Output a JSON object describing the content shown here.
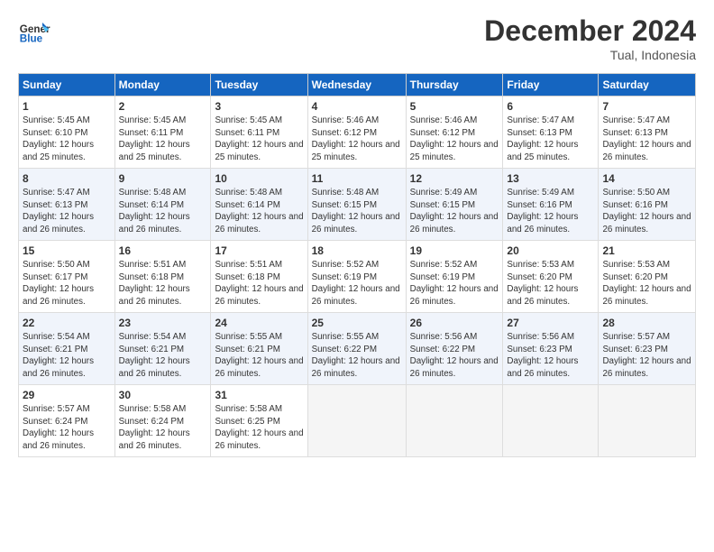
{
  "header": {
    "logo_general": "General",
    "logo_blue": "Blue",
    "month": "December 2024",
    "location": "Tual, Indonesia"
  },
  "weekdays": [
    "Sunday",
    "Monday",
    "Tuesday",
    "Wednesday",
    "Thursday",
    "Friday",
    "Saturday"
  ],
  "weeks": [
    [
      {
        "day": 1,
        "sunrise": "5:45 AM",
        "sunset": "6:10 PM",
        "daylight": "12 hours and 25 minutes."
      },
      {
        "day": 2,
        "sunrise": "5:45 AM",
        "sunset": "6:11 PM",
        "daylight": "12 hours and 25 minutes."
      },
      {
        "day": 3,
        "sunrise": "5:45 AM",
        "sunset": "6:11 PM",
        "daylight": "12 hours and 25 minutes."
      },
      {
        "day": 4,
        "sunrise": "5:46 AM",
        "sunset": "6:12 PM",
        "daylight": "12 hours and 25 minutes."
      },
      {
        "day": 5,
        "sunrise": "5:46 AM",
        "sunset": "6:12 PM",
        "daylight": "12 hours and 25 minutes."
      },
      {
        "day": 6,
        "sunrise": "5:47 AM",
        "sunset": "6:13 PM",
        "daylight": "12 hours and 25 minutes."
      },
      {
        "day": 7,
        "sunrise": "5:47 AM",
        "sunset": "6:13 PM",
        "daylight": "12 hours and 26 minutes."
      }
    ],
    [
      {
        "day": 8,
        "sunrise": "5:47 AM",
        "sunset": "6:13 PM",
        "daylight": "12 hours and 26 minutes."
      },
      {
        "day": 9,
        "sunrise": "5:48 AM",
        "sunset": "6:14 PM",
        "daylight": "12 hours and 26 minutes."
      },
      {
        "day": 10,
        "sunrise": "5:48 AM",
        "sunset": "6:14 PM",
        "daylight": "12 hours and 26 minutes."
      },
      {
        "day": 11,
        "sunrise": "5:48 AM",
        "sunset": "6:15 PM",
        "daylight": "12 hours and 26 minutes."
      },
      {
        "day": 12,
        "sunrise": "5:49 AM",
        "sunset": "6:15 PM",
        "daylight": "12 hours and 26 minutes."
      },
      {
        "day": 13,
        "sunrise": "5:49 AM",
        "sunset": "6:16 PM",
        "daylight": "12 hours and 26 minutes."
      },
      {
        "day": 14,
        "sunrise": "5:50 AM",
        "sunset": "6:16 PM",
        "daylight": "12 hours and 26 minutes."
      }
    ],
    [
      {
        "day": 15,
        "sunrise": "5:50 AM",
        "sunset": "6:17 PM",
        "daylight": "12 hours and 26 minutes."
      },
      {
        "day": 16,
        "sunrise": "5:51 AM",
        "sunset": "6:18 PM",
        "daylight": "12 hours and 26 minutes."
      },
      {
        "day": 17,
        "sunrise": "5:51 AM",
        "sunset": "6:18 PM",
        "daylight": "12 hours and 26 minutes."
      },
      {
        "day": 18,
        "sunrise": "5:52 AM",
        "sunset": "6:19 PM",
        "daylight": "12 hours and 26 minutes."
      },
      {
        "day": 19,
        "sunrise": "5:52 AM",
        "sunset": "6:19 PM",
        "daylight": "12 hours and 26 minutes."
      },
      {
        "day": 20,
        "sunrise": "5:53 AM",
        "sunset": "6:20 PM",
        "daylight": "12 hours and 26 minutes."
      },
      {
        "day": 21,
        "sunrise": "5:53 AM",
        "sunset": "6:20 PM",
        "daylight": "12 hours and 26 minutes."
      }
    ],
    [
      {
        "day": 22,
        "sunrise": "5:54 AM",
        "sunset": "6:21 PM",
        "daylight": "12 hours and 26 minutes."
      },
      {
        "day": 23,
        "sunrise": "5:54 AM",
        "sunset": "6:21 PM",
        "daylight": "12 hours and 26 minutes."
      },
      {
        "day": 24,
        "sunrise": "5:55 AM",
        "sunset": "6:21 PM",
        "daylight": "12 hours and 26 minutes."
      },
      {
        "day": 25,
        "sunrise": "5:55 AM",
        "sunset": "6:22 PM",
        "daylight": "12 hours and 26 minutes."
      },
      {
        "day": 26,
        "sunrise": "5:56 AM",
        "sunset": "6:22 PM",
        "daylight": "12 hours and 26 minutes."
      },
      {
        "day": 27,
        "sunrise": "5:56 AM",
        "sunset": "6:23 PM",
        "daylight": "12 hours and 26 minutes."
      },
      {
        "day": 28,
        "sunrise": "5:57 AM",
        "sunset": "6:23 PM",
        "daylight": "12 hours and 26 minutes."
      }
    ],
    [
      {
        "day": 29,
        "sunrise": "5:57 AM",
        "sunset": "6:24 PM",
        "daylight": "12 hours and 26 minutes."
      },
      {
        "day": 30,
        "sunrise": "5:58 AM",
        "sunset": "6:24 PM",
        "daylight": "12 hours and 26 minutes."
      },
      {
        "day": 31,
        "sunrise": "5:58 AM",
        "sunset": "6:25 PM",
        "daylight": "12 hours and 26 minutes."
      },
      null,
      null,
      null,
      null
    ]
  ]
}
